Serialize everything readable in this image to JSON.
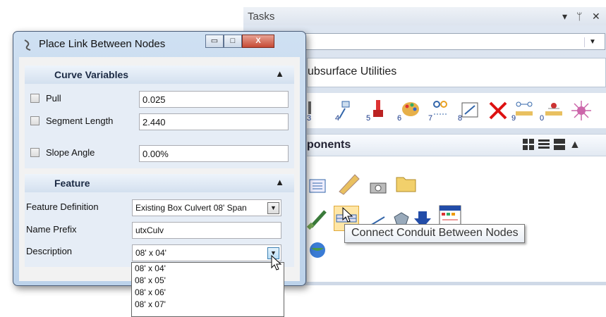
{
  "tasks": {
    "title": "Tasks",
    "pin_symbol": "▾ ⊥ ✕",
    "dropdown_arrow": "▼",
    "subsurface_label": "ubsurface Utilities",
    "tool_numbers": [
      "3",
      "4",
      "5",
      "6",
      "7",
      "8",
      "9",
      "0"
    ],
    "components_label": "ponents",
    "tooltip": "Connect Conduit Between Nodes"
  },
  "dialog": {
    "title": "Place Link Between Nodes",
    "minimize": "▭",
    "maximize": "□",
    "close": "X",
    "curve_section": {
      "label": "Curve Variables",
      "chevron": "▲",
      "rows": [
        {
          "label": "Pull",
          "value": "0.025",
          "checked": false
        },
        {
          "label": "Segment Length",
          "value": "2.440",
          "checked": false
        },
        {
          "label": "Slope Angle",
          "value": "0.00%",
          "checked": false
        }
      ]
    },
    "feature_section": {
      "label": "Feature",
      "chevron": "▲",
      "feature_definition_label": "Feature Definition",
      "feature_definition_value": "Existing Box Culvert 08' Span",
      "name_prefix_label": "Name Prefix",
      "name_prefix_value": "utxCulv",
      "description_label": "Description",
      "description_value": "08' x 04'",
      "description_options": [
        "08' x 04'",
        "08' x 05'",
        "08' x 06'",
        "08' x 07'"
      ]
    }
  },
  "colors": {
    "accent": "#3c7fb1",
    "dialog_frame": "#bcd2ea",
    "close_red": "#c64a35"
  }
}
